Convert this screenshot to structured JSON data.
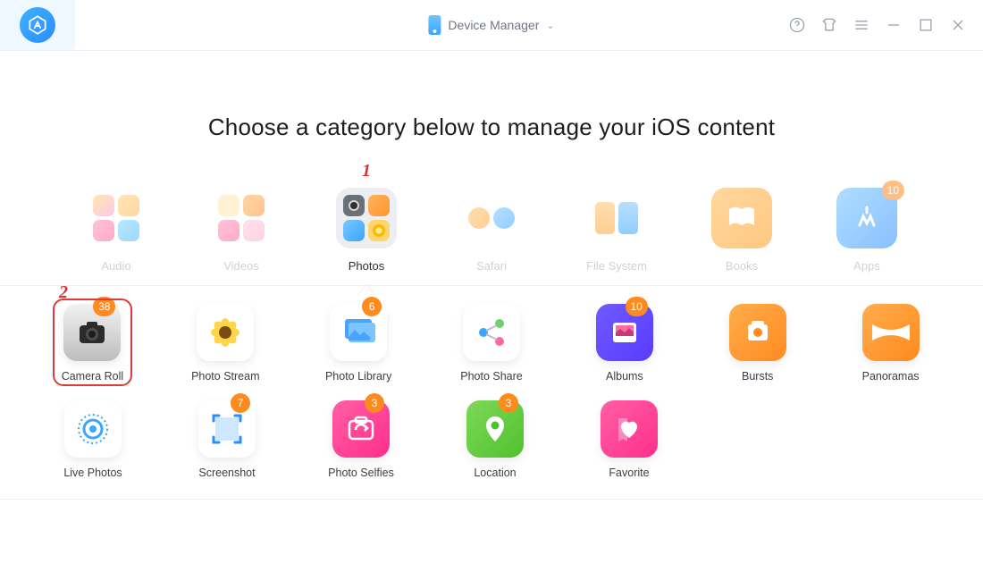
{
  "header": {
    "center_label": "Device Manager"
  },
  "heading": "Choose a category below to manage your iOS content",
  "annotations": {
    "one": "1",
    "two": "2"
  },
  "categories": [
    {
      "id": "audio",
      "label": "Audio",
      "selected": false
    },
    {
      "id": "videos",
      "label": "Videos",
      "selected": false
    },
    {
      "id": "photos",
      "label": "Photos",
      "selected": true
    },
    {
      "id": "safari",
      "label": "Safari",
      "selected": false
    },
    {
      "id": "filesystem",
      "label": "File System",
      "selected": false
    },
    {
      "id": "books",
      "label": "Books",
      "selected": false
    },
    {
      "id": "apps",
      "label": "Apps",
      "selected": false,
      "badge": "10"
    }
  ],
  "sub_items": {
    "row1": [
      {
        "id": "camera-roll",
        "label": "Camera Roll",
        "badge": "38",
        "highlight": true
      },
      {
        "id": "photo-stream",
        "label": "Photo Stream"
      },
      {
        "id": "photo-library",
        "label": "Photo Library",
        "badge": "6"
      },
      {
        "id": "photo-share",
        "label": "Photo Share"
      },
      {
        "id": "albums",
        "label": "Albums",
        "badge": "10"
      },
      {
        "id": "bursts",
        "label": "Bursts"
      },
      {
        "id": "panoramas",
        "label": "Panoramas"
      }
    ],
    "row2": [
      {
        "id": "live-photos",
        "label": "Live Photos"
      },
      {
        "id": "screenshot",
        "label": "Screenshot",
        "badge": "7"
      },
      {
        "id": "photo-selfies",
        "label": "Photo Selfies",
        "badge": "3"
      },
      {
        "id": "location",
        "label": "Location",
        "badge": "3"
      },
      {
        "id": "favorite",
        "label": "Favorite"
      }
    ]
  }
}
